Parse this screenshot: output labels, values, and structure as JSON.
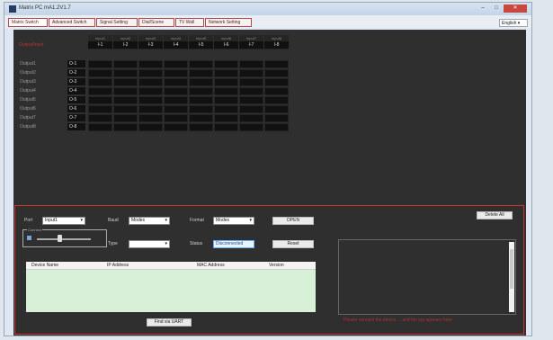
{
  "window": {
    "title": "Matrix PC mA1.2V1.7",
    "min": "–",
    "max": "□",
    "close": "✕"
  },
  "tabs": [
    {
      "label": "Matrix Switch",
      "active": true
    },
    {
      "label": "Advanced Switch",
      "active": false
    },
    {
      "label": "Signal Setting",
      "active": false
    },
    {
      "label": "Dial/Scene",
      "active": false
    },
    {
      "label": "TV Wall",
      "active": false
    },
    {
      "label": "Network Setting",
      "active": false
    }
  ],
  "language": "English",
  "matrix": {
    "corner_label": "Output/Input",
    "inputs": [
      {
        "name": "Input1",
        "id": "I-1"
      },
      {
        "name": "Input2",
        "id": "I-2"
      },
      {
        "name": "Input3",
        "id": "I-3"
      },
      {
        "name": "Input4",
        "id": "I-4"
      },
      {
        "name": "Input5",
        "id": "I-5"
      },
      {
        "name": "Input6",
        "id": "I-6"
      },
      {
        "name": "Input7",
        "id": "I-7"
      },
      {
        "name": "Input8",
        "id": "I-8"
      }
    ],
    "outputs": [
      {
        "name": "Output1",
        "id": "O-1"
      },
      {
        "name": "Output2",
        "id": "O-2"
      },
      {
        "name": "Output3",
        "id": "O-3"
      },
      {
        "name": "Output4",
        "id": "O-4"
      },
      {
        "name": "Output5",
        "id": "O-5"
      },
      {
        "name": "Output6",
        "id": "O-6"
      },
      {
        "name": "Output7",
        "id": "O-7"
      },
      {
        "name": "Output8",
        "id": "O-8"
      }
    ]
  },
  "controls": {
    "clear_button": "Delete All",
    "port_label": "Port",
    "port_value": "Input1",
    "baud_label": "Baud",
    "baud_value": "Modes",
    "format_label": "Format",
    "format_value": "Modes",
    "open_button": "OPEN",
    "group_title": "Connect",
    "type_label": "Type",
    "type_value": "",
    "status_label": "Status",
    "status_value": "Disconnected",
    "reset_button": "Reset",
    "find_button": "Find via UART",
    "log_text": "Please connect the device ... and the log appears here"
  },
  "device_table": {
    "columns": [
      "Device Name",
      "IP Address",
      "MAC Address",
      "Version"
    ]
  },
  "colors": {
    "panel_bg": "#2f2f2f",
    "accent_red": "#cc3333",
    "table_green": "#d9f0d8"
  }
}
